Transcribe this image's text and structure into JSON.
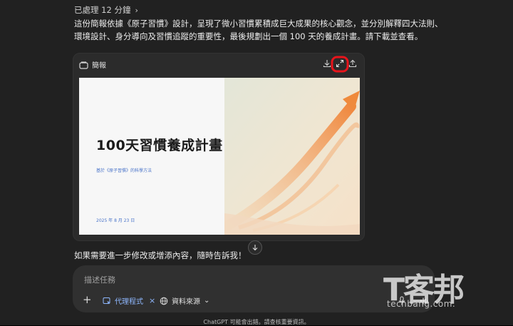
{
  "processed": {
    "label": "已處理 12 分鐘",
    "chevron": "›"
  },
  "message": "這份簡報依據《原子習慣》設計，呈現了微小習慣累積成巨大成果的核心觀念，並分別解釋四大法則、環境設計、身分導向及習慣追蹤的重要性，最後規劃出一個 100 天的養成計畫。請下載並查看。",
  "card": {
    "title": "簡報",
    "icons": [
      "download-icon",
      "expand-icon",
      "share-icon"
    ],
    "highlight_color": "#e8141b"
  },
  "slide": {
    "title": "100天習慣養成計畫",
    "subtitle": "基於《原子習慣》的科學方法",
    "date": "2025 年 8 月 23 日"
  },
  "followup": "如果需要進一步修改或增添內容，隨時告訴我！",
  "composer": {
    "placeholder": "描述任務",
    "plus": "+",
    "agent_label": "代理程式",
    "agent_remove": "×",
    "sources_label": "資料來源",
    "sources_chevron": "⌄"
  },
  "disclaimer": "ChatGPT 可能會出錯。請查核重要資訊。",
  "watermark": {
    "logo": "T客邦",
    "url": "techbang.com."
  }
}
